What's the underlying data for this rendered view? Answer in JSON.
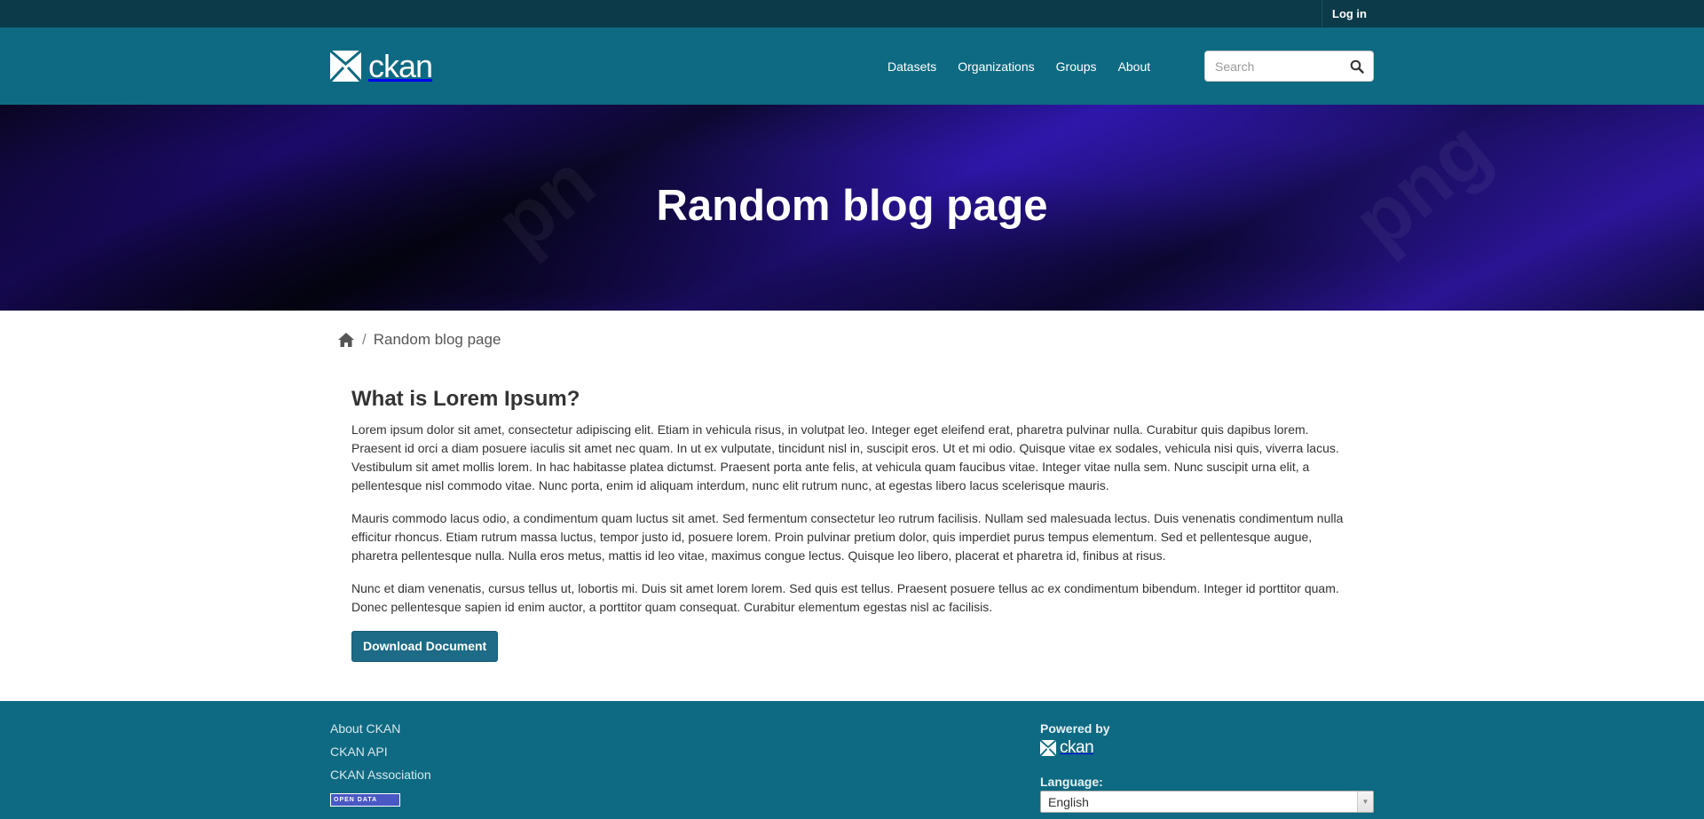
{
  "account": {
    "login_label": "Log in"
  },
  "header": {
    "brand": "ckan",
    "nav": [
      "Datasets",
      "Organizations",
      "Groups",
      "About"
    ],
    "search_placeholder": "Search"
  },
  "hero": {
    "title": "Random blog page"
  },
  "breadcrumb": {
    "current": "Random blog page"
  },
  "article": {
    "heading": "What is Lorem Ipsum?",
    "paragraphs": [
      "Lorem ipsum dolor sit amet, consectetur adipiscing elit. Etiam in vehicula risus, in volutpat leo. Integer eget eleifend erat, pharetra pulvinar nulla. Curabitur quis dapibus lorem. Praesent id orci a diam posuere iaculis sit amet nec quam. In ut ex vulputate, tincidunt nisl in, suscipit eros. Ut et mi odio. Quisque vitae ex sodales, vehicula nisi quis, viverra lacus. Vestibulum sit amet mollis lorem. In hac habitasse platea dictumst. Praesent porta ante felis, at vehicula quam faucibus vitae. Integer vitae nulla sem. Nunc suscipit urna elit, a pellentesque nisl commodo vitae. Nunc porta, enim id aliquam interdum, nunc elit rutrum nunc, at egestas libero lacus scelerisque mauris.",
      "Mauris commodo lacus odio, a condimentum quam luctus sit amet. Sed fermentum consectetur leo rutrum facilisis. Nullam sed malesuada lectus. Duis venenatis condimentum nulla efficitur rhoncus. Etiam rutrum massa luctus, tempor justo id, posuere lorem. Proin pulvinar pretium dolor, quis imperdiet purus tempus elementum. Sed et pellentesque augue, pharetra pellentesque nulla. Nulla eros metus, mattis id leo vitae, maximus congue lectus. Quisque leo libero, placerat et pharetra id, finibus at risus.",
      "Nunc et diam venenatis, cursus tellus ut, lobortis mi. Duis sit amet lorem lorem. Sed quis est tellus. Praesent posuere tellus ac ex condimentum bibendum. Integer id porttitor quam. Donec pellentesque sapien id enim auctor, a porttitor quam consequat. Curabitur elementum egestas nisl ac facilisis."
    ],
    "button_label": "Download Document"
  },
  "footer": {
    "links": [
      "About CKAN",
      "CKAN API",
      "CKAN Association"
    ],
    "open_data_badge": "OPEN DATA",
    "powered_by_label": "Powered by",
    "powered_by_brand": "ckan",
    "language_label": "Language:",
    "language_value": "English"
  },
  "colors": {
    "account_bar": "#0c3a49",
    "masthead": "#0e6a82",
    "button": "#1d6b86",
    "footer": "#0e6a82"
  }
}
